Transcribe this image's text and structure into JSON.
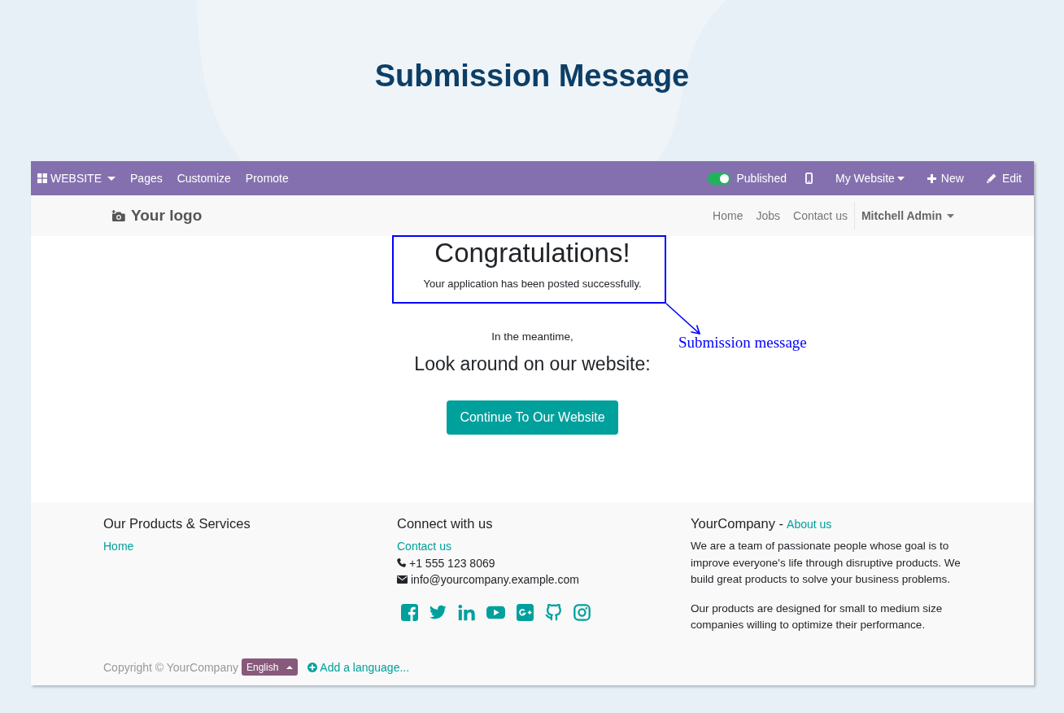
{
  "page_title": "Submission Message",
  "admin_bar": {
    "app_menu": "WEBSITE",
    "menu_items": [
      "Pages",
      "Customize",
      "Promote"
    ],
    "publish_toggle": {
      "label": "Published",
      "on": true
    },
    "website_menu": "My Website",
    "new_button": "New",
    "edit_button": "Edit"
  },
  "navbar": {
    "logo": "Your logo",
    "links": [
      "Home",
      "Jobs",
      "Contact us"
    ],
    "user_menu": "Mitchell Admin"
  },
  "confirmation": {
    "heading": "Congratulations!",
    "message": "Your application has been posted successfully.",
    "meantime": "In the meantime,",
    "subheading": "Look around on our website:",
    "button": "Continue To Our Website"
  },
  "annotation": {
    "label": "Submission message"
  },
  "footer": {
    "products": {
      "heading": "Our Products & Services",
      "links": [
        "Home"
      ]
    },
    "connect": {
      "heading": "Connect with us",
      "contact_link": "Contact us",
      "phone": "+1 555 123 8069",
      "email": "info@yourcompany.example.com"
    },
    "about": {
      "title": "YourCompany -",
      "link": "About us",
      "paragraphs": [
        "We are a team of passionate people whose goal is to improve everyone's life through disruptive products. We build great products to solve your business problems.",
        "Our products are designed for small to medium size companies willing to optimize their performance."
      ]
    },
    "copyright": "Copyright © YourCompany",
    "language": "English",
    "add_language": "Add a language..."
  }
}
